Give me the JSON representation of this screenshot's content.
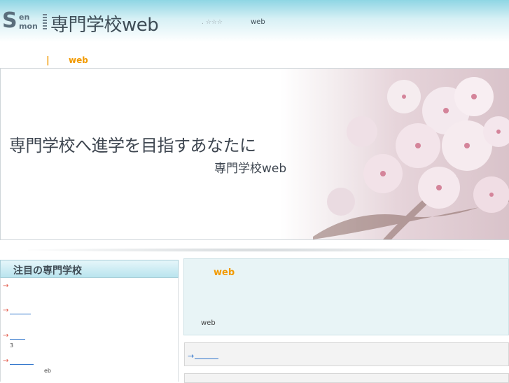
{
  "header": {
    "logo_s": "S",
    "logo_en": "en",
    "logo_mon": "mon",
    "title": "専門学校web",
    "stars": ". ☆☆☆",
    "web_label": "web"
  },
  "breadcrumb": {
    "separator": "|",
    "current": "web"
  },
  "hero": {
    "headline": "専門学校へ進学を目指すあなたに",
    "subline": "専門学校web"
  },
  "sidebar": {
    "heading": "注目の専門学校",
    "arrow": "→",
    "item3_note": "3",
    "item4_note": "eb"
  },
  "main": {
    "title": "web",
    "footer_web": "web",
    "link_arrow": "→"
  },
  "colors": {
    "accent_orange": "#f29a00",
    "header_teal": "#8fd6e4",
    "link_blue": "#3377cc",
    "arrow_red": "#e25a4a"
  }
}
